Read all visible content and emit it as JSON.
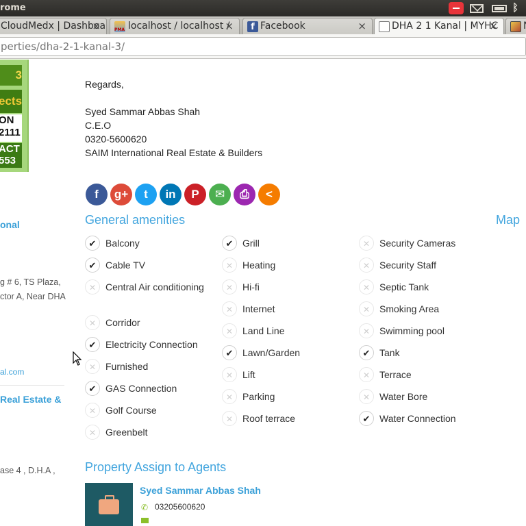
{
  "system": {
    "title": "rome"
  },
  "tabs": [
    {
      "label": "CloudMedx | Dashboa",
      "close": "×"
    },
    {
      "label": "localhost / localhost /",
      "close": "×",
      "favicon_text": "PMA"
    },
    {
      "label": "Facebook",
      "close": "×",
      "favicon_text": "f"
    },
    {
      "label": "DHA 2 1 Kanal | MYHC",
      "close": "×"
    },
    {
      "label": "N"
    }
  ],
  "address": {
    "url": "perties/dha-2-1-kanal-3/"
  },
  "sidebar": {
    "ad_lines": [
      "3",
      "ects",
      "ON",
      "2111",
      "ACT",
      "553"
    ],
    "link1": "onal",
    "address_line1": "g # 6, TS Plaza,",
    "address_line2": "ctor A, Near DHA",
    "email_fragment": "al.com",
    "link2": "Real Estate &",
    "address_line3": "ase 4 , D.H.A ,"
  },
  "regards": {
    "greeting": "Regards,",
    "name": "Syed Sammar Abbas Shah",
    "title": "C.E.O",
    "phone": "0320-5600620",
    "company": "SAIM International Real Estate & Builders"
  },
  "share": [
    {
      "name": "facebook",
      "glyph": "f",
      "color": "#3b5998"
    },
    {
      "name": "google-plus",
      "glyph": "g+",
      "color": "#dd4b39"
    },
    {
      "name": "twitter",
      "glyph": "t",
      "color": "#1da1f2"
    },
    {
      "name": "linkedin",
      "glyph": "in",
      "color": "#0077b5"
    },
    {
      "name": "pinterest",
      "glyph": "P",
      "color": "#cb2027"
    },
    {
      "name": "email",
      "glyph": "✉",
      "color": "#4caf50"
    },
    {
      "name": "print",
      "glyph": "⎙",
      "color": "#9c27b0"
    },
    {
      "name": "share",
      "glyph": "<",
      "color": "#f57c00"
    }
  ],
  "amenities": {
    "title": "General amenities",
    "map_label": "Map",
    "columns": [
      [
        {
          "label": "Balcony",
          "available": true
        },
        {
          "label": "Cable TV",
          "available": true
        },
        {
          "label": "Central Air conditioning",
          "available": false
        },
        {
          "label": "Corridor",
          "available": false
        },
        {
          "label": "Electricity Connection",
          "available": true
        },
        {
          "label": "Furnished",
          "available": false
        },
        {
          "label": "GAS Connection",
          "available": true
        },
        {
          "label": "Golf Course",
          "available": false
        },
        {
          "label": "Greenbelt",
          "available": false
        }
      ],
      [
        {
          "label": "Grill",
          "available": true
        },
        {
          "label": "Heating",
          "available": false
        },
        {
          "label": "Hi-fi",
          "available": false
        },
        {
          "label": "Internet",
          "available": false
        },
        {
          "label": "Land Line",
          "available": false
        },
        {
          "label": "Lawn/Garden",
          "available": true
        },
        {
          "label": "Lift",
          "available": false
        },
        {
          "label": "Parking",
          "available": false
        },
        {
          "label": "Roof terrace",
          "available": false
        }
      ],
      [
        {
          "label": "Security Cameras",
          "available": false
        },
        {
          "label": "Security Staff",
          "available": false
        },
        {
          "label": "Septic Tank",
          "available": false
        },
        {
          "label": "Smoking Area",
          "available": false
        },
        {
          "label": "Swimming pool",
          "available": false
        },
        {
          "label": "Tank",
          "available": true
        },
        {
          "label": "Terrace",
          "available": false
        },
        {
          "label": "Water Bore",
          "available": false
        },
        {
          "label": "Water Connection",
          "available": true
        }
      ]
    ],
    "yes_glyph": "✔",
    "no_glyph": "✕"
  },
  "agents": {
    "title": "Property Assign to Agents",
    "name": "Syed Sammar Abbas Shah",
    "phone": "03205600620"
  }
}
